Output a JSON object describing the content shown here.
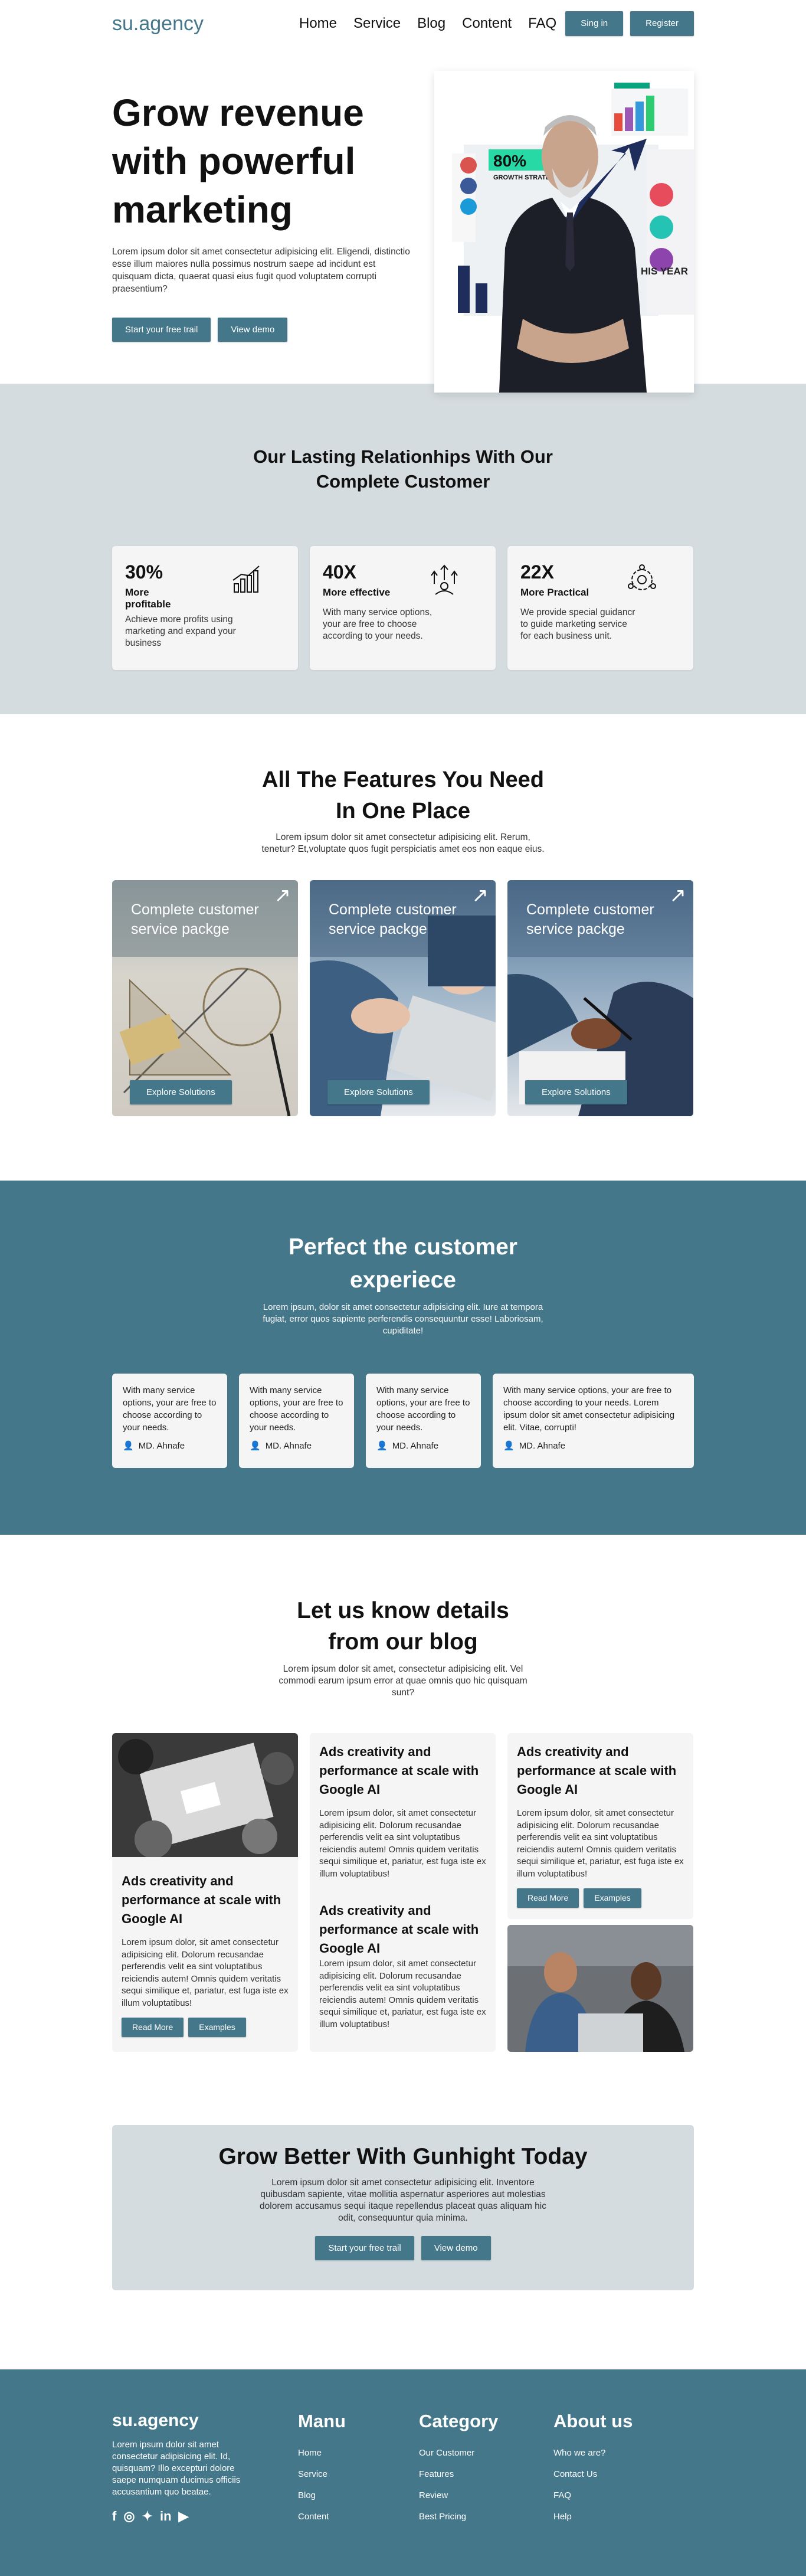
{
  "header": {
    "logo": "su.agency",
    "nav": [
      "Home",
      "Service",
      "Blog",
      "Content",
      "FAQ"
    ],
    "signin_label": "Sing in",
    "register_label": "Register"
  },
  "hero": {
    "title": "Grow revenue with powerful marketing",
    "text": "Lorem ipsum dolor sit amet consectetur adipisicing elit. Eligendi, distinctio esse illum maiores nulla possimus nostrum saepe ad incidunt est quisquam dicta, quaerat quasi eius fugit quod voluptatem corrupti praesentium?",
    "primary_cta": "Start your free trail",
    "secondary_cta": "View demo",
    "illustration": {
      "percent": "80%",
      "caption": "GROWTH STRATEGIES",
      "side": "HIS YEAR"
    }
  },
  "relationships": {
    "title_line1": "Our Lasting Relationhips With Our",
    "title_line2": "Complete Customer",
    "stats": [
      {
        "num": "30%",
        "label": "More profitable",
        "text": "Achieve more profits using marketing and expand your business",
        "icon": "chart-growth-icon"
      },
      {
        "num": "40X",
        "label": "More effective",
        "text": "With many service options, your are free to choose according to your needs.",
        "icon": "arrows-up-icon"
      },
      {
        "num": "22X",
        "label": "More Practical",
        "text": "We provide special guidancr to guide marketing service for each business unit.",
        "icon": "gears-icon"
      }
    ]
  },
  "features": {
    "title_line1": "All The Features You Need",
    "title_line2": "In One Place",
    "subtitle": "Lorem ipsum dolor sit amet consectetur adipisicing elit. Rerum, tenetur? Et,voluptate quos fugit perspiciatis amet eos non eaque eius.",
    "cards": [
      {
        "title": "Complete customer service packge",
        "button": "Explore Solutions"
      },
      {
        "title": "Complete customer service packge",
        "button": "Explore Solutions"
      },
      {
        "title": "Complete customer service packge",
        "button": "Explore Solutions"
      }
    ]
  },
  "experience": {
    "title_line1": "Perfect the customer",
    "title_line2": "experiece",
    "text": "Lorem ipsum, dolor sit amet consectetur adipisicing elit. Iure at tempora fugiat, error quos sapiente perferendis consequuntur esse! Laboriosam, cupiditate!",
    "cards": [
      {
        "text": "With many service options, your are free to choose according to your needs.",
        "author": "MD. Ahnafe"
      },
      {
        "text": "With many service options, your are free to choose according to your needs.",
        "author": "MD. Ahnafe"
      },
      {
        "text": "With many service options, your are free to choose according to your needs.",
        "author": "MD. Ahnafe"
      },
      {
        "text": "With many service options, your are free to choose according to your needs. Lorem ipsum dolor sit amet consectetur adipisicing elit. Vitae, corrupti!",
        "author": "MD. Ahnafe"
      }
    ]
  },
  "blog": {
    "title_line1": "Let us know details",
    "title_line2": "from our blog",
    "subtitle": "Lorem ipsum dolor sit amet, consectetur adipisicing elit. Vel commodi earum ipsum error at quae omnis quo hic quisquam sunt?",
    "post_title": "Ads creativity and performance at scale with Google AI",
    "post_text": "Lorem ipsum dolor, sit amet consectetur adipisicing elit. Dolorum recusandae perferendis velit ea sint voluptatibus reiciendis autem! Omnis quidem veritatis sequi similique et, pariatur, est fuga iste ex illum voluptatibus!",
    "read_more": "Read More",
    "examples": "Examples"
  },
  "cta": {
    "title": "Grow Better With Gunhight Today",
    "text": "Lorem ipsum dolor sit amet consectetur adipisicing elit. Inventore quibusdam sapiente, vitae mollitia aspernatur asperiores aut molestias dolorem accusamus sequi itaque repellendus placeat quas aliquam hic odit, consequuntur quia minima.",
    "primary": "Start your free trail",
    "secondary": "View demo"
  },
  "footer": {
    "logo": "su.agency",
    "about": "Lorem ipsum dolor sit amet consectetur adipisicing elit. Id, quisquam? Illo excepturi dolore saepe numquam ducimus officiis accusantium quo beatae.",
    "social": [
      "facebook-icon",
      "instagram-icon",
      "twitter-icon",
      "linkedin-icon",
      "youtube-icon"
    ],
    "menu_title": "Manu",
    "menu": [
      "Home",
      "Service",
      "Blog",
      "Content"
    ],
    "category_title": "Category",
    "category": [
      "Our Customer",
      "Features",
      "Review",
      "Best Pricing"
    ],
    "about_title": "About us",
    "about_links": [
      "Who we are?",
      "Contact Us",
      "FAQ",
      "Help"
    ]
  },
  "colors": {
    "accent": "#45778b",
    "band": "#d5dcdf",
    "card": "#f5f5f5"
  }
}
